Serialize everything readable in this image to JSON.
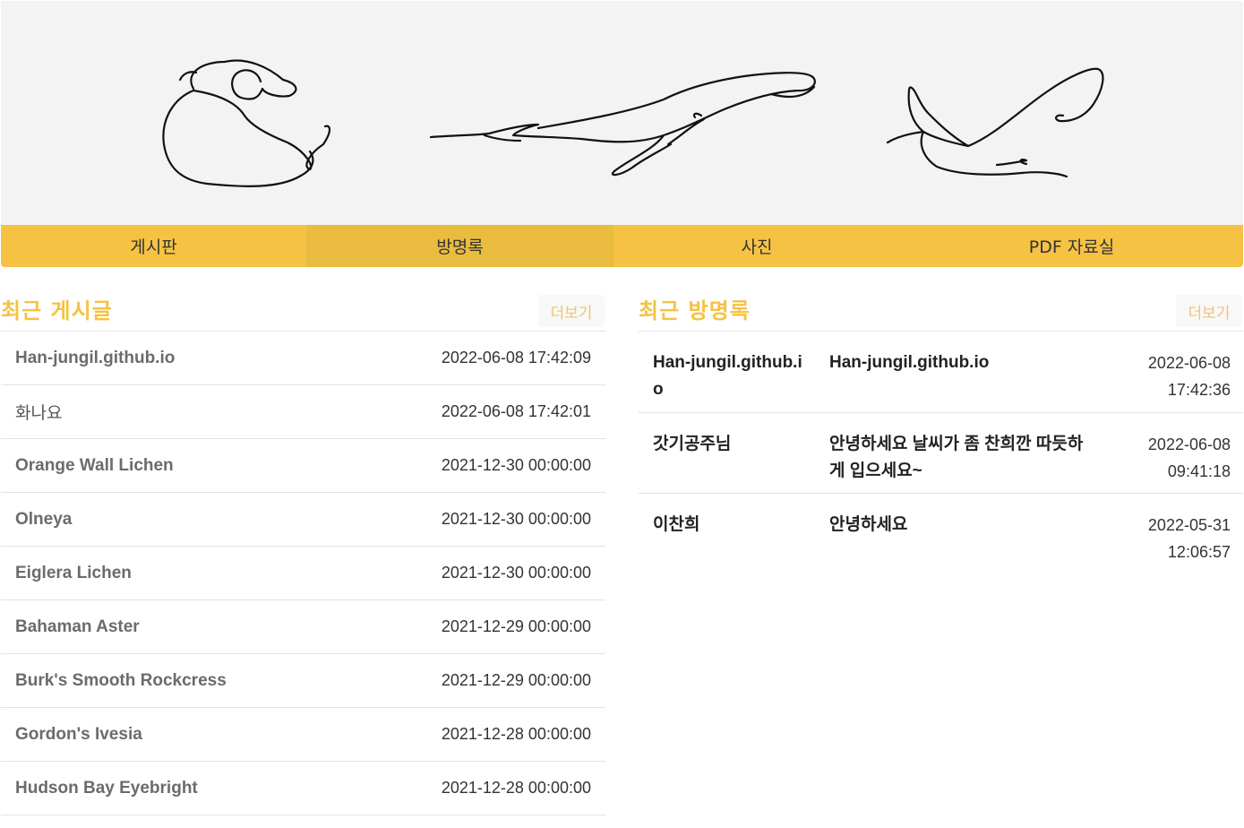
{
  "nav": {
    "items": [
      {
        "label": "게시판"
      },
      {
        "label": "방명록"
      },
      {
        "label": "사진"
      },
      {
        "label": "PDF 자료실"
      }
    ]
  },
  "recent_posts": {
    "title": "최근 게시글",
    "more_label": "더보기",
    "rows": [
      {
        "title": "Han-jungil.github.io",
        "date": "2022-06-08 17:42:09"
      },
      {
        "title": "화나요",
        "date": "2022-06-08 17:42:01"
      },
      {
        "title": "Orange Wall Lichen",
        "date": "2021-12-30 00:00:00"
      },
      {
        "title": "Olneya",
        "date": "2021-12-30 00:00:00"
      },
      {
        "title": "Eiglera Lichen",
        "date": "2021-12-30 00:00:00"
      },
      {
        "title": "Bahaman Aster",
        "date": "2021-12-29 00:00:00"
      },
      {
        "title": "Burk's Smooth Rockcress",
        "date": "2021-12-29 00:00:00"
      },
      {
        "title": "Gordon's Ivesia",
        "date": "2021-12-28 00:00:00"
      },
      {
        "title": "Hudson Bay Eyebright",
        "date": "2021-12-28 00:00:00"
      }
    ]
  },
  "recent_guestbook": {
    "title": "최근 방명록",
    "more_label": "더보기",
    "rows": [
      {
        "author": "Han-jungil.github.io",
        "content": "Han-jungil.github.io",
        "date": "2022-06-08 17:42:36"
      },
      {
        "author": "갓기공주님",
        "content": "안녕하세요 날씨가 좀 찬희깐 따듯하게 입으세요~",
        "date": "2022-06-08 09:41:18"
      },
      {
        "author": "이찬희",
        "content": "안녕하세요",
        "date": "2022-05-31 12:06:57"
      }
    ]
  }
}
